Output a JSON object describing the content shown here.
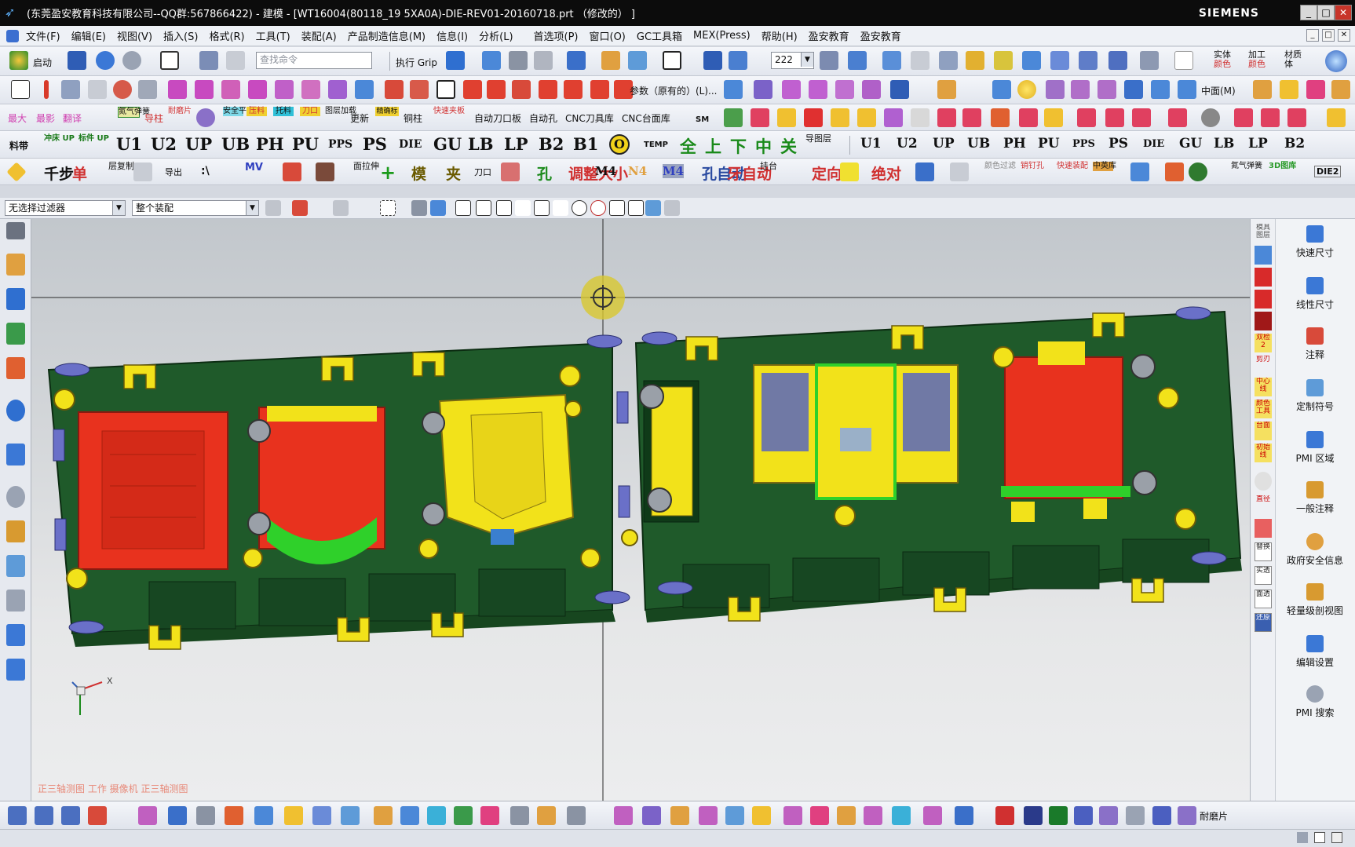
{
  "window": {
    "title": "(东莞盈安教育科技有限公司--QQ群:567866422) - 建模 - [WT16004(80118_19 5XA0A)-DIE-REV01-20160718.prt （修改的） ]",
    "brand": "SIEMENS"
  },
  "menu": [
    "文件(F)",
    "编辑(E)",
    "视图(V)",
    "插入(S)",
    "格式(R)",
    "工具(T)",
    "装配(A)",
    "产品制造信息(M)",
    "信息(I)",
    "分析(L)",
    "首选项(P)",
    "窗口(O)",
    "GC工具箱",
    "MEX(Press)",
    "帮助(H)",
    "盈安教育",
    "盈安教育"
  ],
  "toolbar1": {
    "start_label": "启动",
    "search_placeholder": "查找命令",
    "grip_label": "执行 Grip",
    "layer_value": "222",
    "mfg_label": "加工",
    "mfg_sub": "颜色",
    "material_label": "材质",
    "material_sub": "体",
    "solid_label": "实体",
    "solid_sub": "颜色"
  },
  "toolbar2": {
    "param_label": "参数（原有的）(L)...",
    "center_label": "中面(M)"
  },
  "toolbar3": {
    "labels": [
      "最大",
      "最影",
      "翻译",
      "氮气弹簧",
      "导柱",
      "耐磨片",
      "吊环",
      "安全平台",
      "压料",
      "托料",
      "刀口",
      "图层加载",
      "更新",
      "精确标",
      "铜柱",
      "快速夹板"
    ],
    "plain": [
      "自动刀口板",
      "自动孔",
      "CNC刀具库",
      "CNC台面库"
    ],
    "sm": "SM"
  },
  "toolbar4": {
    "pre": [
      "料带",
      "冲床 UP",
      "标件 UP"
    ],
    "big": [
      "U1",
      "U2",
      "UP",
      "UB",
      "PH",
      "PU",
      "PPS",
      "PS",
      "DIE",
      "GU",
      "LB",
      "LP",
      "B2",
      "B1"
    ],
    "circle": "O",
    "temp": "TEMP",
    "cn": [
      "全",
      "上",
      "下",
      "中",
      "关"
    ],
    "layer": "导图层",
    "small": [
      "U1",
      "U2",
      "UP",
      "UB",
      "PH",
      "PU",
      "PPS",
      "PS",
      "DIE",
      "GU",
      "LB",
      "LP",
      "B2"
    ]
  },
  "toolbar5": {
    "labels": [
      "千步",
      "单",
      "层复制",
      "导出",
      "MV",
      "面拉伸",
      "模",
      "夹",
      "刀口",
      "孔",
      "调整大小",
      "M4",
      "N4",
      "M4",
      "孔自动",
      "牙自动",
      "挂台",
      "定向",
      "绝对",
      "颜色过滤",
      "销钉孔",
      "快速装配",
      "中英库",
      "氮气弹簧",
      "3D图库",
      "DIE2"
    ],
    "backslash": ":\\"
  },
  "selection": {
    "filter": "无选择过滤器",
    "scope": "整个装配"
  },
  "viewport": {
    "watermark": "正三轴测图 工作 摄像机 正三轴测图",
    "axis_x": "X"
  },
  "strip": {
    "items": [
      "模具图层",
      "",
      "",
      "",
      "",
      "双检 2",
      "剪刃",
      "中心线",
      "颜色工具",
      "台面",
      "初始线",
      "",
      "直径",
      "",
      "替换",
      "实透",
      "面透",
      "还原"
    ]
  },
  "rightpanel": [
    "快速尺寸",
    "线性尺寸",
    "注释",
    "定制符号",
    "PMI 区域",
    "一般注释",
    "政府安全信息",
    "轻量级剖视图",
    "编辑设置",
    "PMI 搜索"
  ],
  "bottombar": {
    "end_label": "耐磨片"
  },
  "colors": {
    "plate": "#1f5a2a",
    "red_insert": "#e8321e",
    "yellow_part": "#f2e21a",
    "blue_part": "#4f5fc8"
  }
}
